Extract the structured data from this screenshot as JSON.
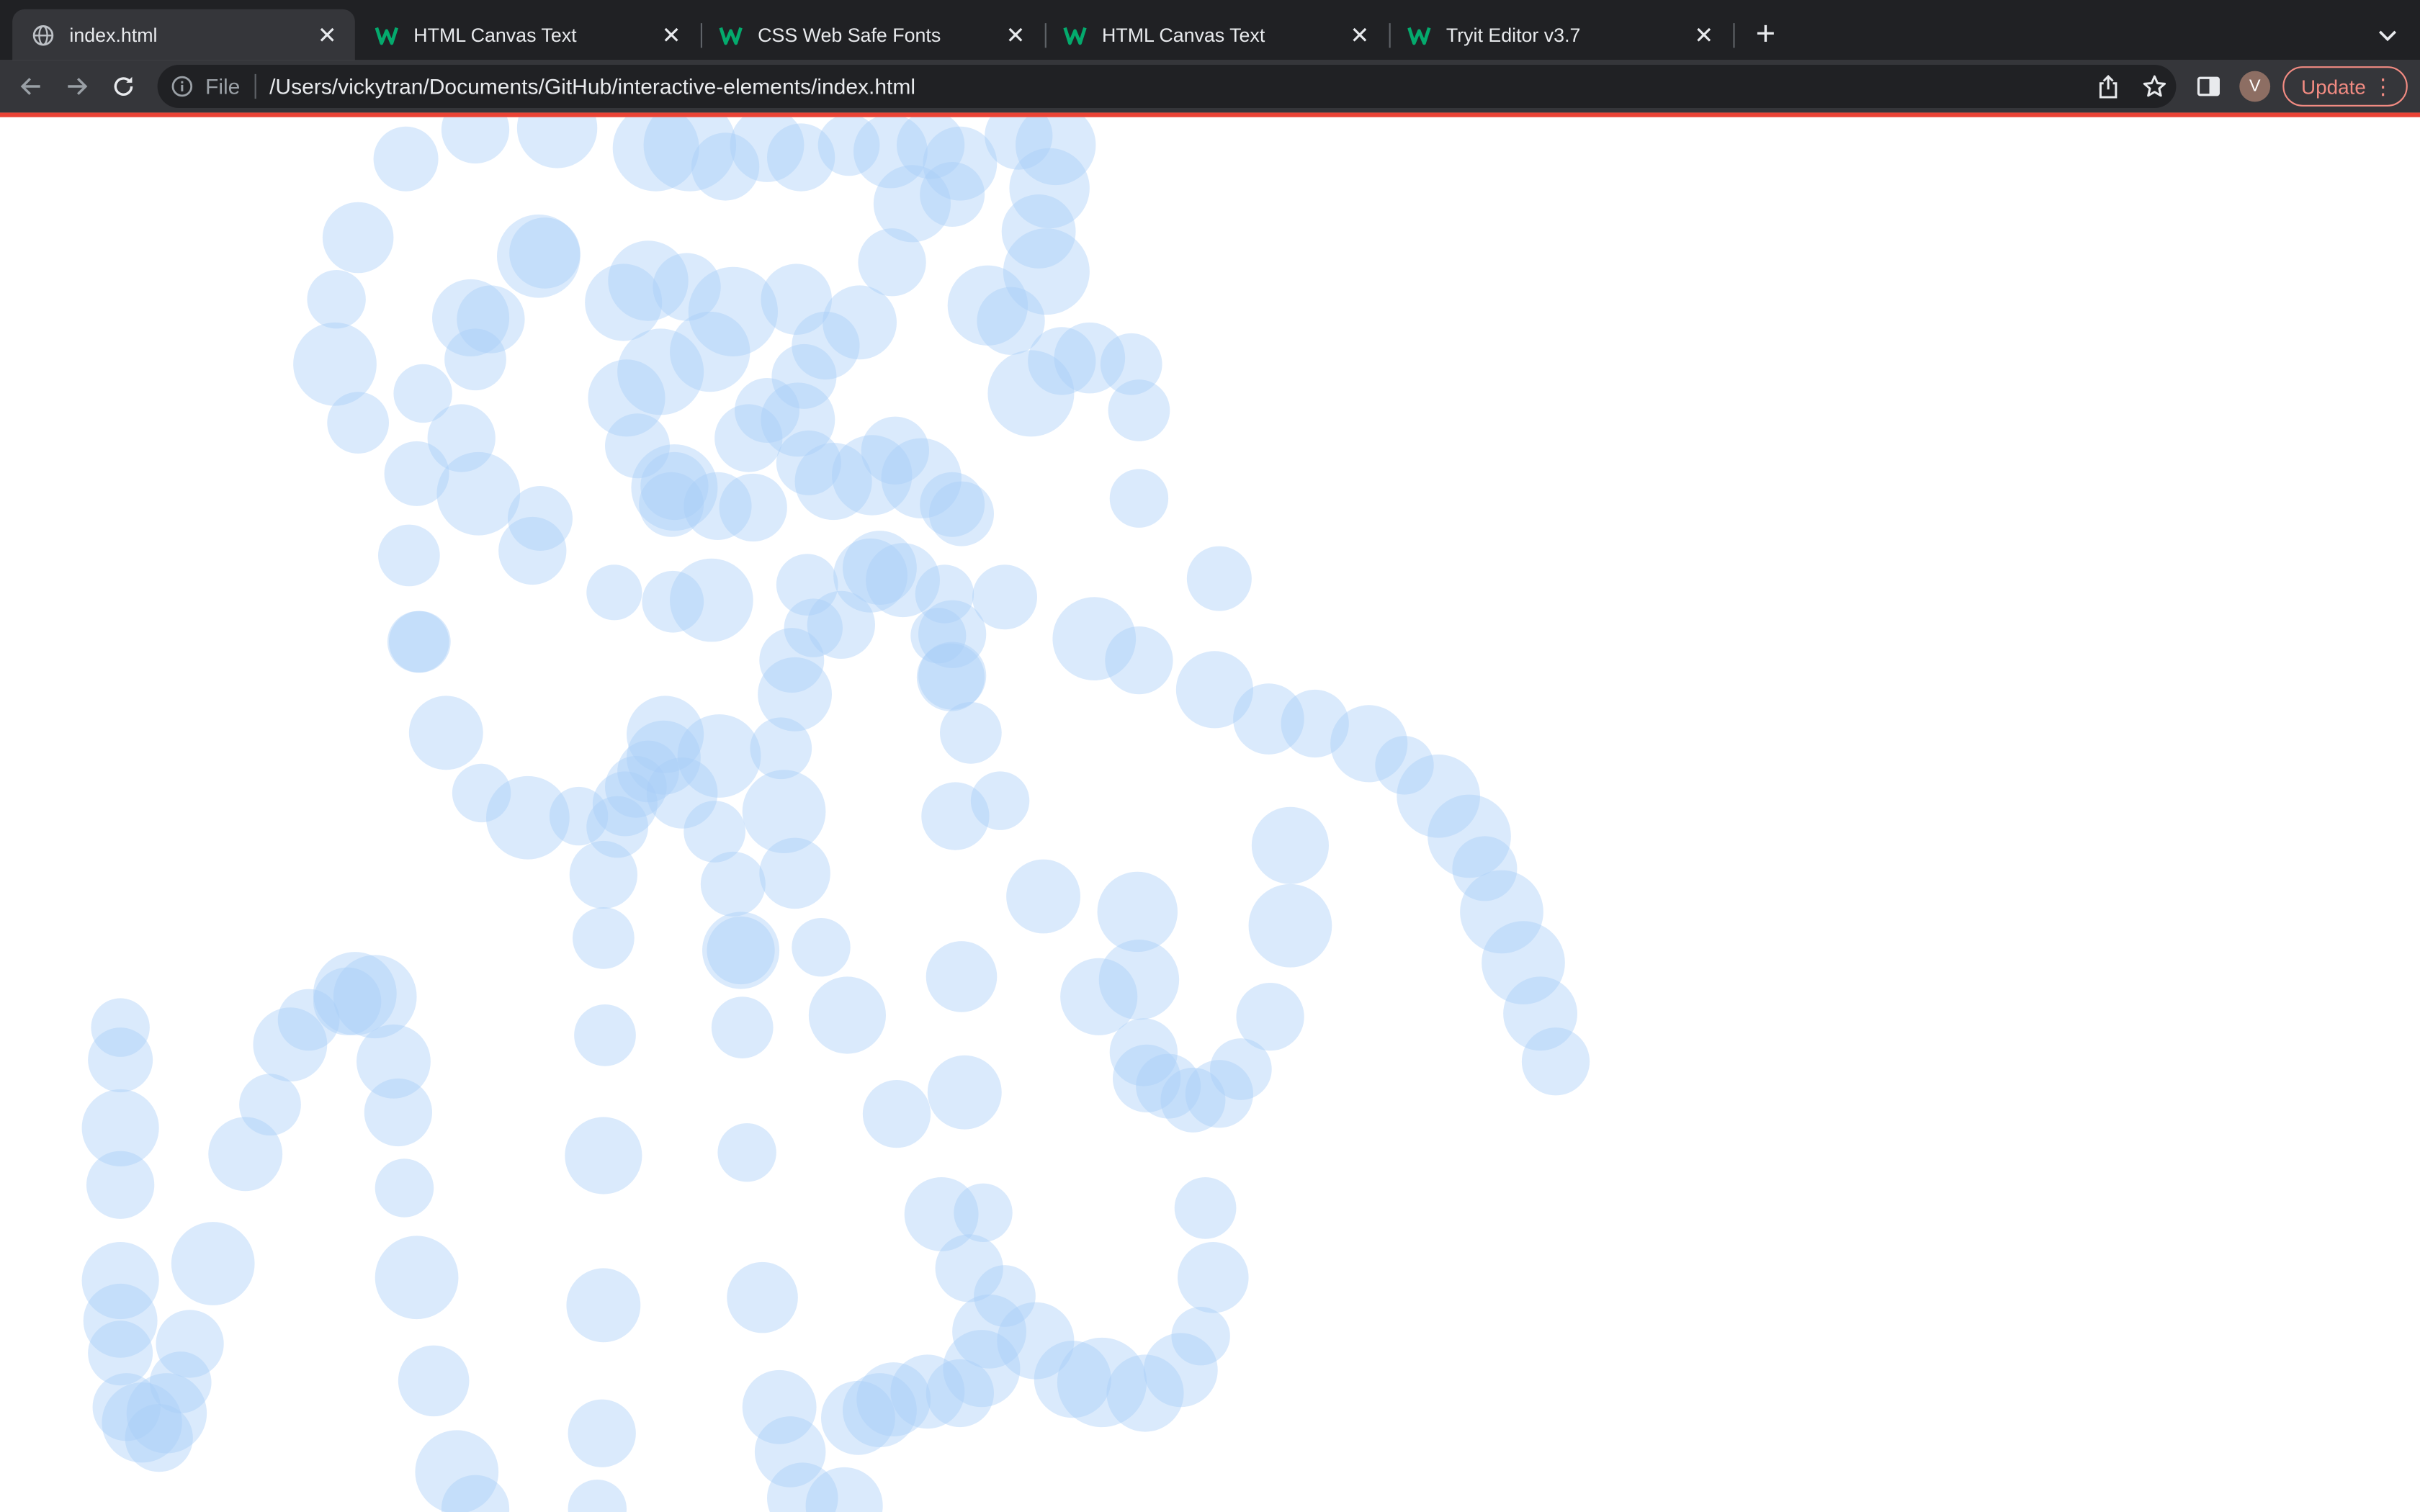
{
  "browser": {
    "tabs": [
      {
        "title": "index.html",
        "icon": "globe-icon",
        "active": true
      },
      {
        "title": "HTML Canvas Text",
        "icon": "w3schools-icon",
        "active": false
      },
      {
        "title": "CSS Web Safe Fonts",
        "icon": "w3schools-icon",
        "active": false
      },
      {
        "title": "HTML Canvas Text",
        "icon": "w3schools-icon",
        "active": false
      },
      {
        "title": "Tryit Editor v3.7",
        "icon": "w3schools-icon",
        "active": false
      }
    ],
    "address": {
      "scheme_label": "File",
      "url": "/Users/vickytran/Documents/GitHub/interactive-elements/index.html"
    },
    "profile_initial": "V",
    "update_label": "Update"
  },
  "colors": {
    "tab_strip": "#202124",
    "toolbar": "#35363a",
    "loading_bar": "#ea4335",
    "w3schools_green": "#04aa6d",
    "bubble_fill": "#a6cdf7",
    "update_accent": "#f28b82"
  }
}
